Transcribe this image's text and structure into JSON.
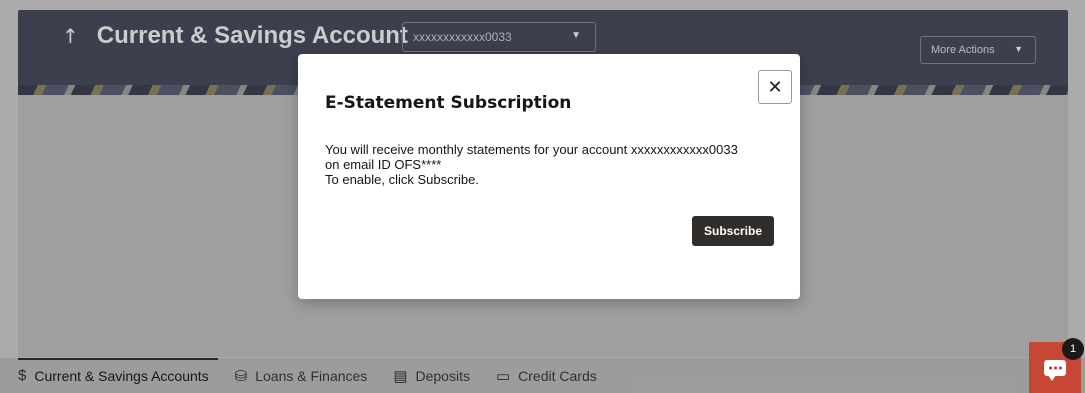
{
  "header": {
    "title": "Current & Savings Account",
    "account_select_value": "xxxxxxxxxxxx0033",
    "more_actions_label": "More Actions"
  },
  "modal": {
    "title": "E-Statement Subscription",
    "close_glyph": "✕",
    "body_lines": [
      "You will receive monthly statements for your account xxxxxxxxxxxx0033",
      "on email ID OFS****",
      "To enable, click Subscribe."
    ],
    "subscribe_label": "Subscribe"
  },
  "tabs": [
    {
      "label": "Current & Savings Accounts",
      "icon": "dollar-circle-icon",
      "active": true
    },
    {
      "label": "Loans & Finances",
      "icon": "hand-coins-icon",
      "active": false
    },
    {
      "label": "Deposits",
      "icon": "ledger-icon",
      "active": false
    },
    {
      "label": "Credit Cards",
      "icon": "credit-card-icon",
      "active": false
    }
  ],
  "chat": {
    "icon": "chat-bubble-icon",
    "badge_count": "1",
    "accent_color": "#c74634"
  }
}
